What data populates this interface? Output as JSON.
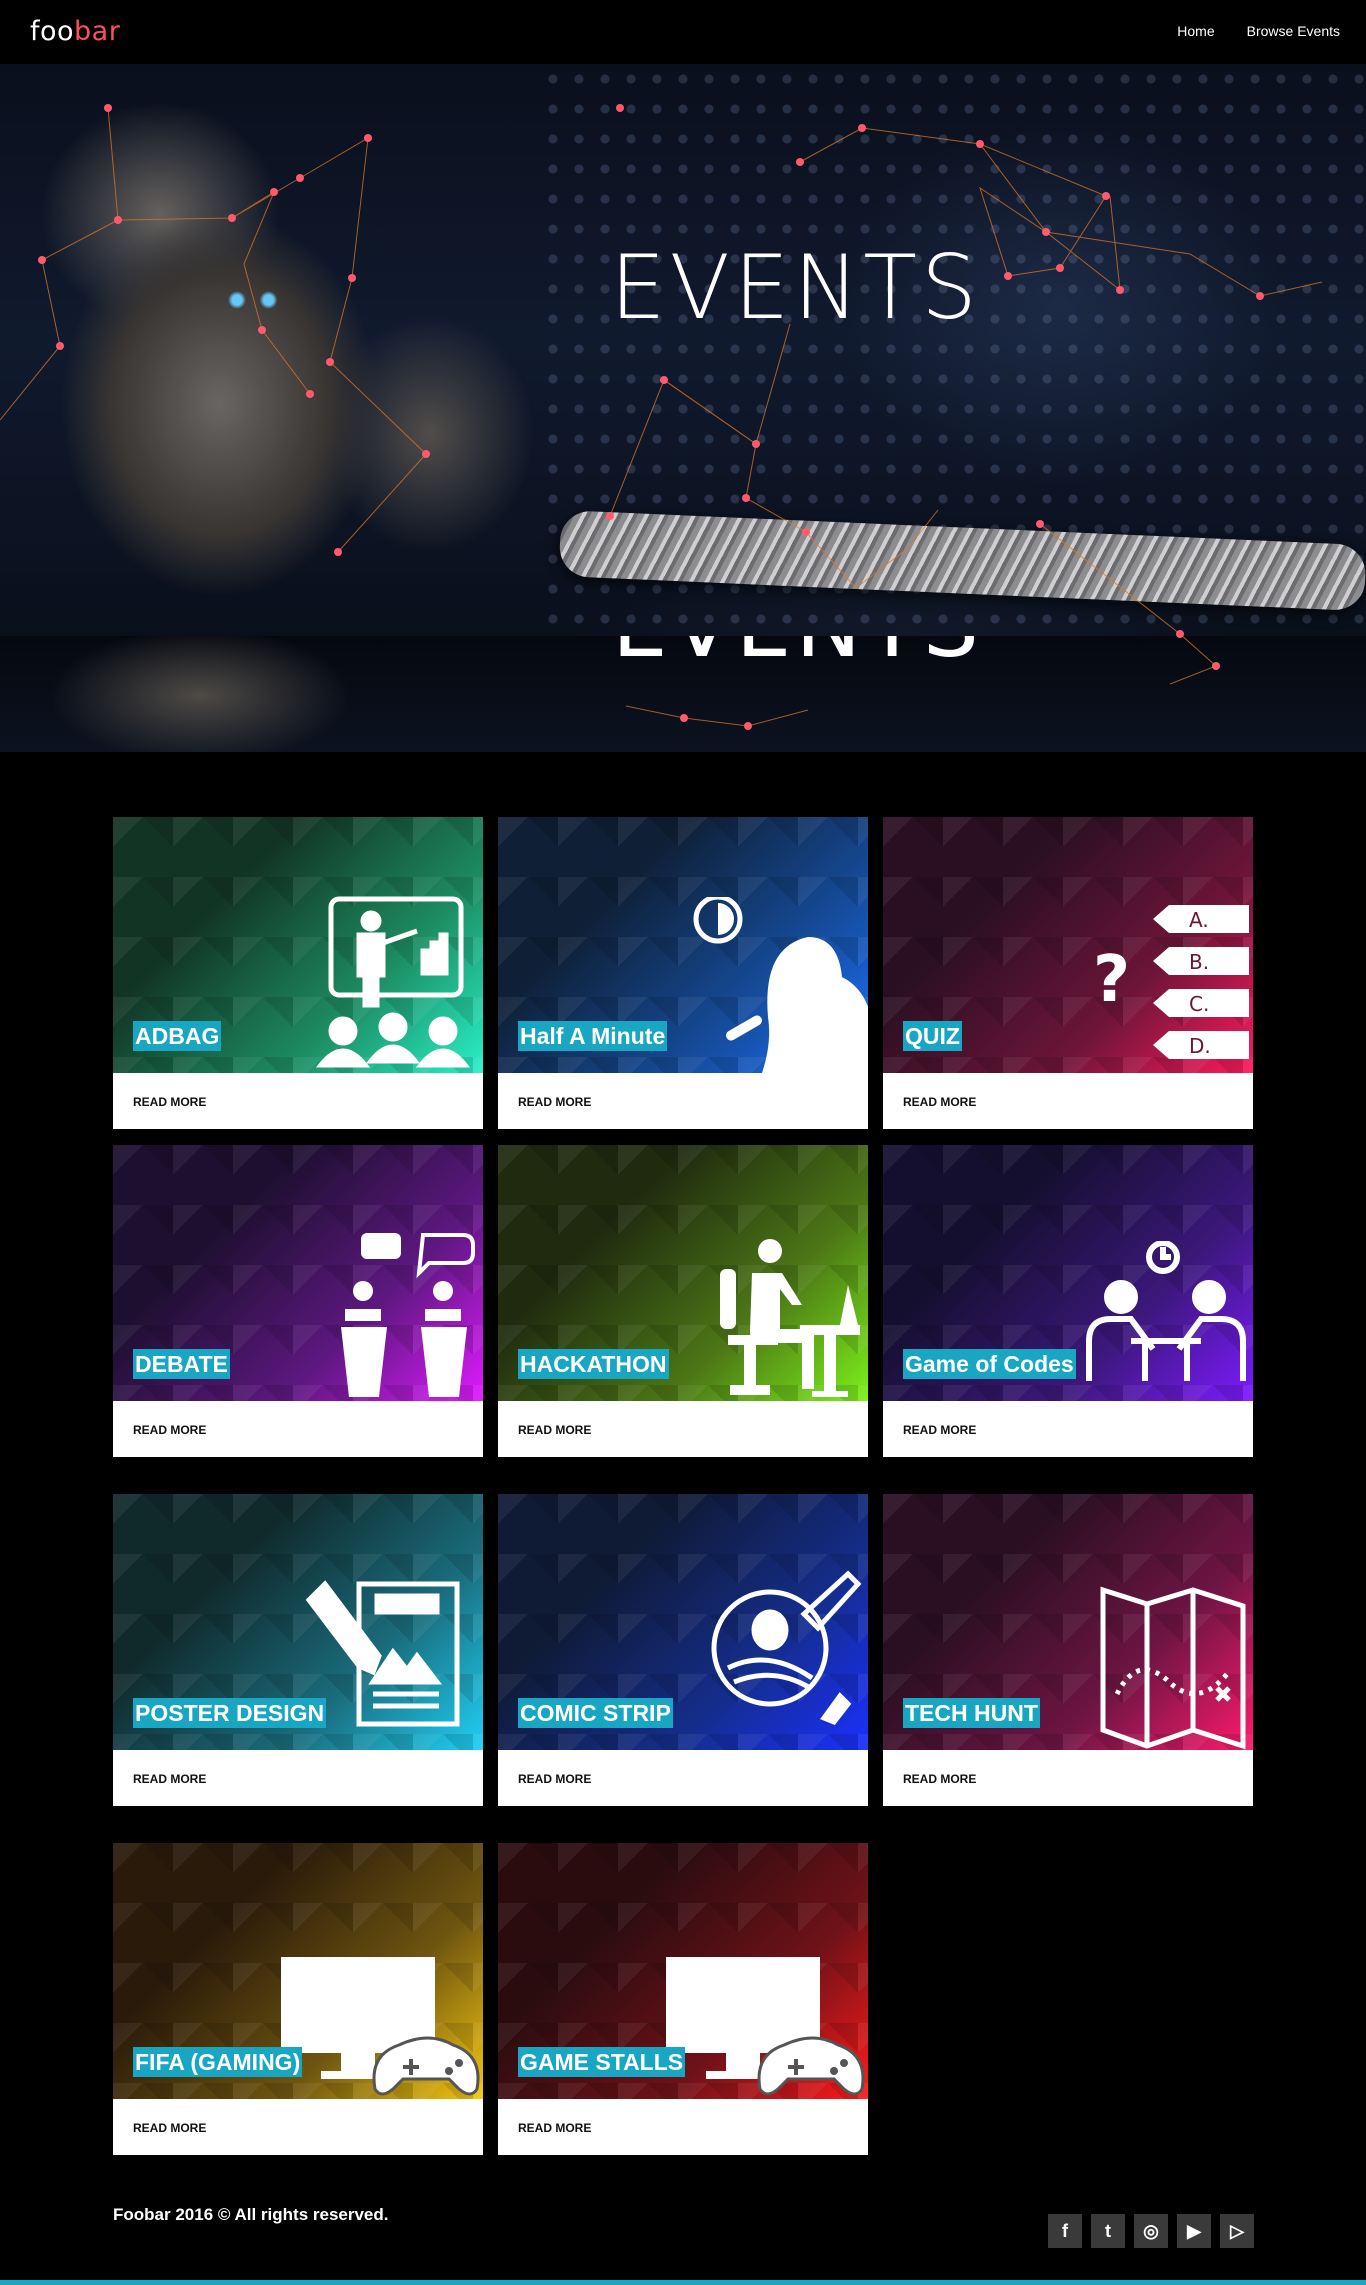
{
  "nav": {
    "logo_part1": "foo",
    "logo_part2": "bar",
    "links": [
      "Home",
      "Browse Events"
    ]
  },
  "hero": {
    "title": "EVENTS"
  },
  "events": [
    {
      "name": "ADBAG",
      "cta": "READ MORE",
      "colors": [
        "#123425",
        "#1d8c62",
        "#29f0c8"
      ],
      "icon": "presentation-icon"
    },
    {
      "name": "Half A Minute",
      "cta": "READ MORE",
      "colors": [
        "#0f1f35",
        "#154a96",
        "#1b70ff"
      ],
      "icon": "speaker-icon"
    },
    {
      "name": "QUIZ",
      "cta": "READ MORE",
      "colors": [
        "#2a0f22",
        "#6d1538",
        "#ff1a5e"
      ],
      "icon": "quiz-icon"
    },
    {
      "name": "DEBATE",
      "cta": "READ MORE",
      "colors": [
        "#1d0f2f",
        "#5d1880",
        "#e01aff"
      ],
      "icon": "debate-icon"
    },
    {
      "name": "HACKATHON",
      "cta": "READ MORE",
      "colors": [
        "#1f2a0f",
        "#4c7716",
        "#7cf01a"
      ],
      "icon": "hackathon-icon"
    },
    {
      "name": "Game of Codes",
      "cta": "READ MORE",
      "colors": [
        "#140f2f",
        "#3b187a",
        "#7d1aff"
      ],
      "icon": "game-of-codes-icon"
    },
    {
      "name": "POSTER DESIGN",
      "cta": "READ MORE",
      "colors": [
        "#10292b",
        "#1a6c7c",
        "#1fd0f5"
      ],
      "icon": "poster-icon"
    },
    {
      "name": "COMIC STRIP",
      "cta": "READ MORE",
      "colors": [
        "#0f1a35",
        "#142d8a",
        "#1a30ff"
      ],
      "icon": "comic-icon"
    },
    {
      "name": "TECH HUNT",
      "cta": "READ MORE",
      "colors": [
        "#2a0f22",
        "#6e1543",
        "#ff1a6c"
      ],
      "icon": "map-icon"
    },
    {
      "name": "FIFA (GAMING)",
      "cta": "READ MORE",
      "colors": [
        "#2a1a0a",
        "#6e5510",
        "#f5c60f"
      ],
      "icon": "gaming-icon"
    },
    {
      "name": "GAME STALLS",
      "cta": "READ MORE",
      "colors": [
        "#2a0c0f",
        "#6e1218",
        "#ff1a1a"
      ],
      "icon": "gaming-icon"
    }
  ],
  "footer": {
    "copyright": "Foobar 2016 © All rights reserved.",
    "social": [
      {
        "icon": "facebook-icon",
        "glyph": "f"
      },
      {
        "icon": "twitter-icon",
        "glyph": "t"
      },
      {
        "icon": "instagram-icon",
        "glyph": "◎"
      },
      {
        "icon": "youtube-icon",
        "glyph": "▶"
      },
      {
        "icon": "play-store-icon",
        "glyph": "▷"
      }
    ],
    "accent": "#18a6c2"
  }
}
